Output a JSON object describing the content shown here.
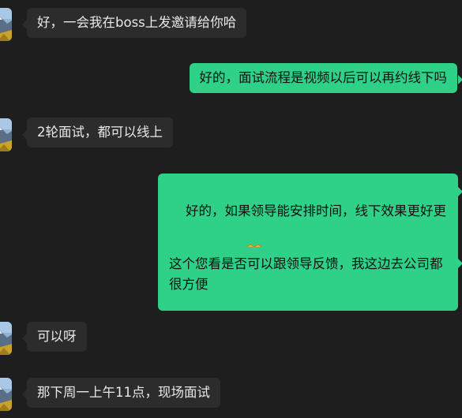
{
  "chat": {
    "messages": [
      {
        "side": "received",
        "text": "好，一会我在boss上发邀请给你哈"
      },
      {
        "side": "sent",
        "text": "好的，面试流程是视频以后可以再约线下吗"
      },
      {
        "side": "received",
        "text": "2轮面试，都可以线上"
      },
      {
        "side": "sent",
        "text": "好的，如果领导能安排时间，线下效果更好更充分一些",
        "emoji": "handshake-icon"
      },
      {
        "side": "sent",
        "text": "这个您看是否可以跟领导反馈，我这边去公司都很方便"
      },
      {
        "side": "received",
        "text": "可以呀"
      },
      {
        "side": "received",
        "text": "那下周一上午11点，现场面试"
      }
    ]
  },
  "colors": {
    "background": "#1e1e1e",
    "received_bubble": "#2c2c2c",
    "sent_bubble": "#2fd087",
    "received_text": "#e8e8e8",
    "sent_text": "#111111"
  }
}
